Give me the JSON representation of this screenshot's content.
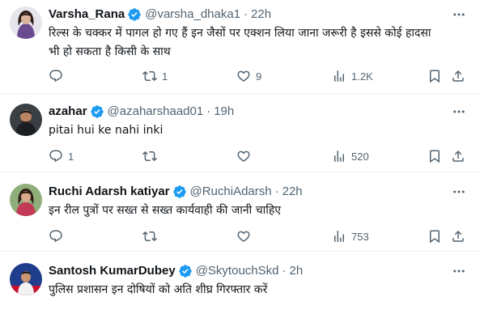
{
  "tweets": [
    {
      "name": "Varsha_Rana",
      "handle": "@varsha_dhaka1",
      "separator": "·",
      "time": "22h",
      "text_line1": "रिल्स के चक्कर में पागल हो गए हैं इन जैसों पर एक्शन लिया जाना जरूरी है इससे कोई हादसा",
      "text_line2": "भी हो सकता है किसी के साथ",
      "replies": "",
      "reposts": "1",
      "likes": "9",
      "views": "1.2K"
    },
    {
      "name": "azahar",
      "handle": "@azaharshaad01",
      "separator": "·",
      "time": "19h",
      "text_line1": "pitai hui ke nahi inki",
      "replies": "1",
      "reposts": "",
      "likes": "",
      "views": "520"
    },
    {
      "name": "Ruchi Adarsh katiyar",
      "handle": "@RuchiAdarsh",
      "separator": "·",
      "time": "22h",
      "text_line1": "इन रील पुत्रों पर सख्त से सख्त कार्यवाही की जानी चाहिए",
      "replies": "",
      "reposts": "",
      "likes": "",
      "views": "753"
    },
    {
      "name": "Santosh KumarDubey",
      "handle": "@SkytouchSkd",
      "separator": "·",
      "time": "2h",
      "text_line1": "पुलिस प्रशासन इन दोषियों को अति शीघ्र गिरफ्तार करें"
    }
  ],
  "icons": {
    "verified": "verified-badge-icon",
    "more": "more-icon",
    "reply": "reply-icon",
    "repost": "repost-icon",
    "like": "heart-icon",
    "views": "views-icon",
    "bookmark": "bookmark-icon",
    "share": "share-icon"
  },
  "colors": {
    "verified": "#1d9bf0",
    "text": "#0f1419",
    "secondary": "#536471",
    "divider": "#eff3f4"
  }
}
